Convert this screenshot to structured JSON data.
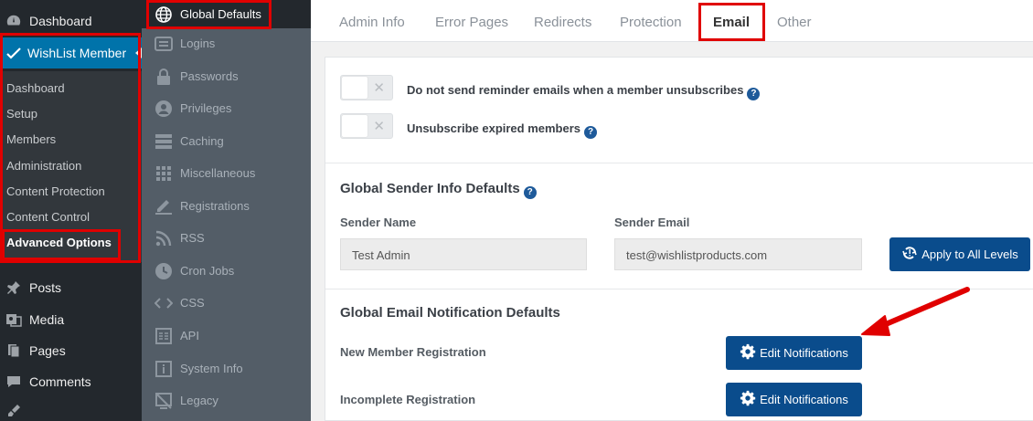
{
  "wp_sidebar": {
    "dashboard": "Dashboard",
    "wishlist_member": "WishList Member",
    "submenu": [
      "Dashboard",
      "Setup",
      "Members",
      "Administration",
      "Content Protection",
      "Content Control",
      "Advanced Options"
    ],
    "posts": "Posts",
    "media": "Media",
    "pages": "Pages",
    "comments": "Comments"
  },
  "settings_nav": [
    {
      "label": "Global Defaults",
      "icon": "globe-icon"
    },
    {
      "label": "Logins",
      "icon": "login-icon"
    },
    {
      "label": "Passwords",
      "icon": "lock-icon"
    },
    {
      "label": "Privileges",
      "icon": "user-icon"
    },
    {
      "label": "Caching",
      "icon": "server-icon"
    },
    {
      "label": "Miscellaneous",
      "icon": "grid-icon"
    },
    {
      "label": "Registrations",
      "icon": "pencil-icon"
    },
    {
      "label": "RSS",
      "icon": "rss-icon"
    },
    {
      "label": "Cron Jobs",
      "icon": "clock-icon"
    },
    {
      "label": "CSS",
      "icon": "code-icon"
    },
    {
      "label": "API",
      "icon": "api-icon"
    },
    {
      "label": "System Info",
      "icon": "info-icon"
    },
    {
      "label": "Legacy",
      "icon": "legacy-icon"
    }
  ],
  "tabs": [
    "Admin Info",
    "Error Pages",
    "Redirects",
    "Protection",
    "Email",
    "Other"
  ],
  "active_tab": "Email",
  "toggles": [
    {
      "label": "Do not send reminder emails when a member unsubscribes",
      "on": false
    },
    {
      "label": "Unsubscribe expired members",
      "on": false
    }
  ],
  "sender_section": {
    "title": "Global Sender Info Defaults",
    "name_label": "Sender Name",
    "name_value": "Test Admin",
    "email_label": "Sender Email",
    "email_value": "test@wishlistproducts.com",
    "apply_button": "Apply to All Levels"
  },
  "notification_section": {
    "title": "Global Email Notification Defaults",
    "rows": [
      {
        "label": "New Member Registration",
        "button": "Edit Notifications"
      },
      {
        "label": "Incomplete Registration",
        "button": "Edit Notifications"
      }
    ]
  },
  "colors": {
    "accent": "#0073aa",
    "button": "#0a4c8c",
    "highlight": "#e00000"
  }
}
